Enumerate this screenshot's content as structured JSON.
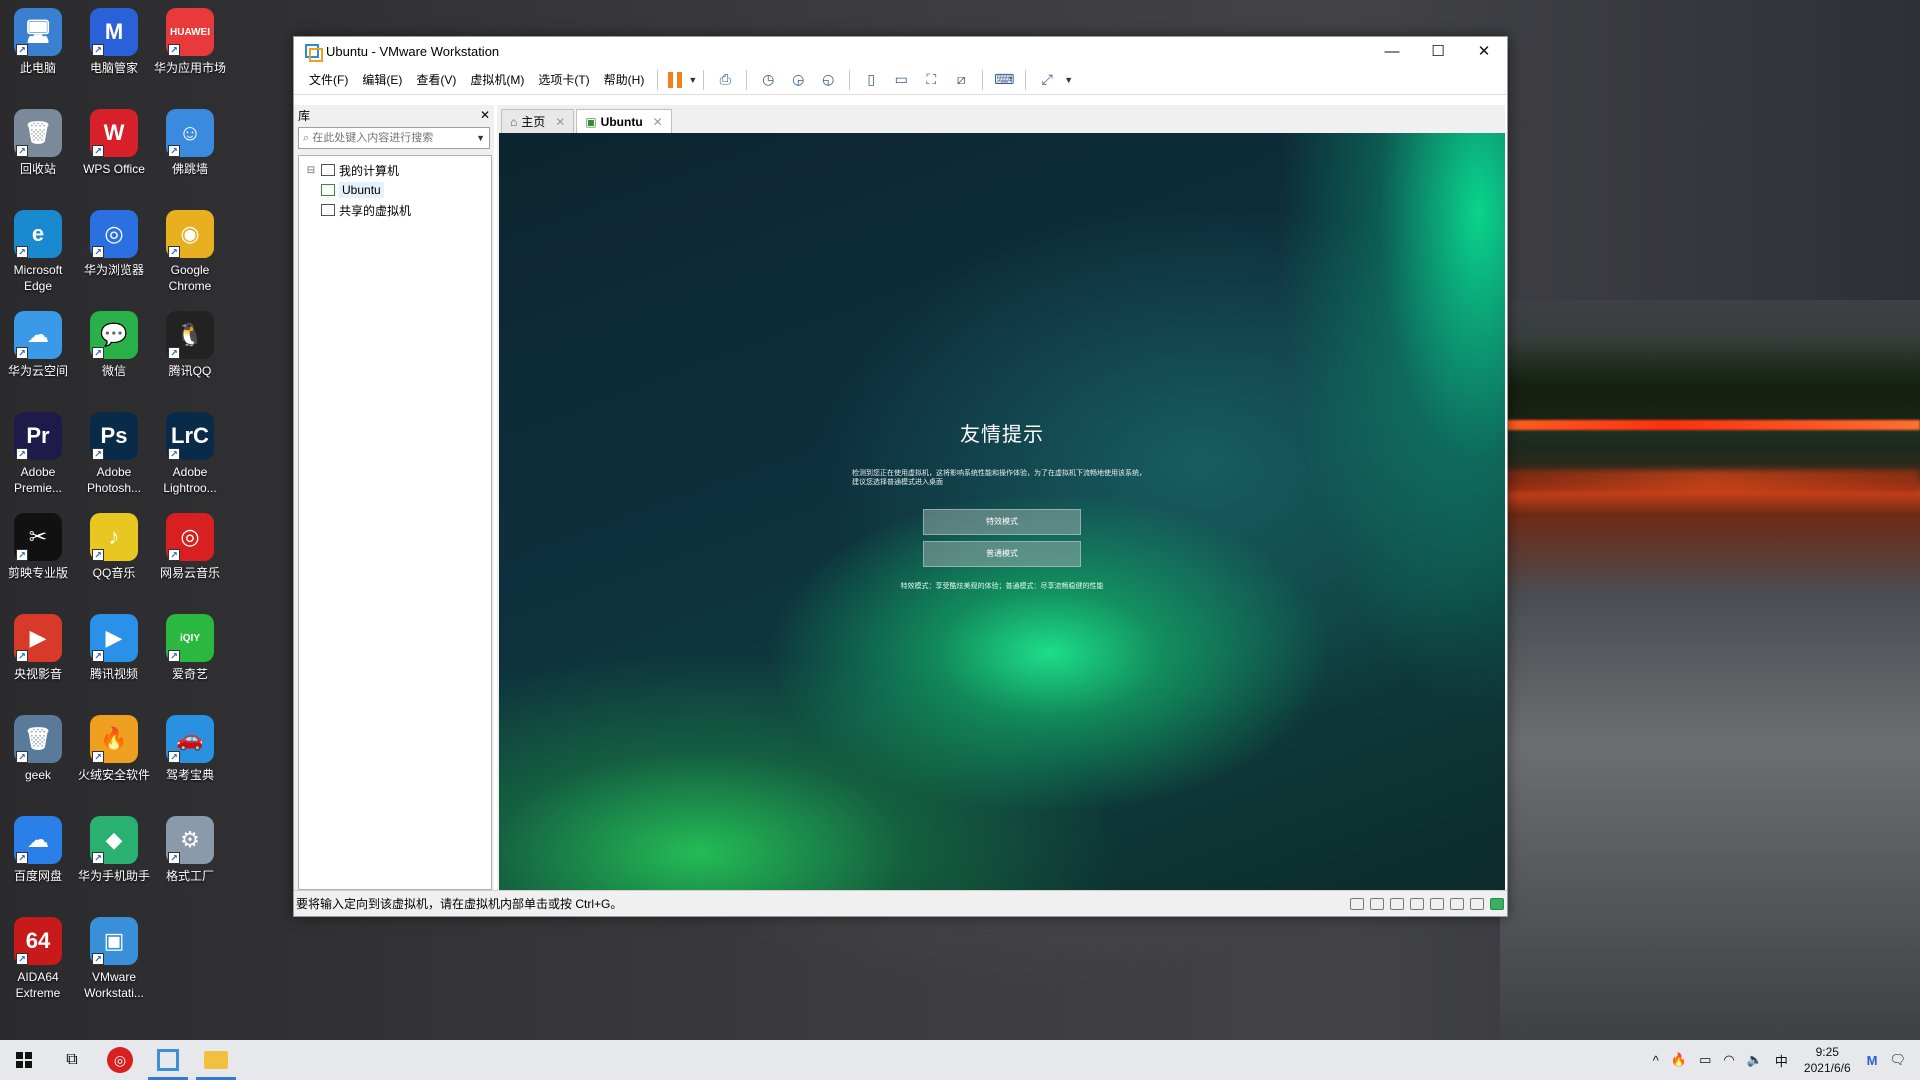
{
  "desktop": {
    "icons": [
      {
        "label": "此电脑",
        "glyph": "🖥",
        "color": "#3a7fd0"
      },
      {
        "label": "电脑管家",
        "glyph": "M",
        "color": "#2a60d8"
      },
      {
        "label": "华为应用市场",
        "glyph": "HUAWEI",
        "color": "#e83a3a"
      },
      {
        "label": "回收站",
        "glyph": "🗑",
        "color": "#7a8a9a"
      },
      {
        "label": "WPS Office",
        "glyph": "W",
        "color": "#d8202a"
      },
      {
        "label": "佛跳墙",
        "glyph": "☺",
        "color": "#3a8ae0"
      },
      {
        "label": "Microsoft Edge",
        "glyph": "e",
        "color": "#1a8ad0"
      },
      {
        "label": "华为浏览器",
        "glyph": "◎",
        "color": "#2a70e0"
      },
      {
        "label": "Google Chrome",
        "glyph": "◉",
        "color": "#e8b020"
      },
      {
        "label": "华为云空间",
        "glyph": "☁",
        "color": "#3a9ae8"
      },
      {
        "label": "微信",
        "glyph": "💬",
        "color": "#2ab048"
      },
      {
        "label": "腾讯QQ",
        "glyph": "🐧",
        "color": "#222"
      },
      {
        "label": "Adobe Premie...",
        "glyph": "Pr",
        "color": "#1e1a4a"
      },
      {
        "label": "Adobe Photosh...",
        "glyph": "Ps",
        "color": "#0a2a4a"
      },
      {
        "label": "Adobe Lightroo...",
        "glyph": "LrC",
        "color": "#0a2a4a"
      },
      {
        "label": "剪映专业版",
        "glyph": "✂",
        "color": "#111"
      },
      {
        "label": "QQ音乐",
        "glyph": "♪",
        "color": "#e8c820"
      },
      {
        "label": "网易云音乐",
        "glyph": "◎",
        "color": "#d82020"
      },
      {
        "label": "央视影音",
        "glyph": "▶",
        "color": "#d83a2a"
      },
      {
        "label": "腾讯视频",
        "glyph": "▶",
        "color": "#2a90e8"
      },
      {
        "label": "爱奇艺",
        "glyph": "iQIY",
        "color": "#2ab840"
      },
      {
        "label": "geek",
        "glyph": "🗑",
        "color": "#5a7a9a"
      },
      {
        "label": "火绒安全软件",
        "glyph": "🔥",
        "color": "#f0a020"
      },
      {
        "label": "驾考宝典",
        "glyph": "🚗",
        "color": "#2a90e0"
      },
      {
        "label": "百度网盘",
        "glyph": "☁",
        "color": "#2a80e8"
      },
      {
        "label": "华为手机助手",
        "glyph": "◆",
        "color": "#2ab070"
      },
      {
        "label": "格式工厂",
        "glyph": "⚙",
        "color": "#8a9aaa"
      },
      {
        "label": "AIDA64 Extreme",
        "glyph": "64",
        "color": "#c81a1a"
      },
      {
        "label": "VMware Workstati...",
        "glyph": "▣",
        "color": "#3a90d8"
      }
    ]
  },
  "window": {
    "title": "Ubuntu - VMware Workstation",
    "minimize": "—",
    "maximize": "☐",
    "close": "✕"
  },
  "menu": {
    "file": "文件(F)",
    "edit": "编辑(E)",
    "view": "查看(V)",
    "vm": "虚拟机(M)",
    "tabs": "选项卡(T)",
    "help": "帮助(H)"
  },
  "library": {
    "title": "库",
    "close": "✕",
    "search_placeholder": "在此处键入内容进行搜索",
    "tree": {
      "my_computer": "我的计算机",
      "ubuntu": "Ubuntu",
      "shared": "共享的虚拟机"
    }
  },
  "tabs": [
    {
      "label": "主页",
      "close": "✕"
    },
    {
      "label": "Ubuntu",
      "close": "✕"
    }
  ],
  "guest": {
    "title": "友情提示",
    "message": "检测到您正在使用虚拟机，这将影响系统性能和操作体验，为了在虚拟机下流畅地使用该系统，建议您选择普通模式进入桌面",
    "effects_button": "特效模式",
    "normal_button": "普通模式",
    "note": "特效模式：享受酷炫美观的体验；普通模式：尽享流畅稳健的性能"
  },
  "statusbar": {
    "message": "要将输入定向到该虚拟机，请在虚拟机内部单击或按 Ctrl+G。"
  },
  "taskbar": {
    "time": "9:25",
    "date": "2021/6/6",
    "ime": "中"
  }
}
